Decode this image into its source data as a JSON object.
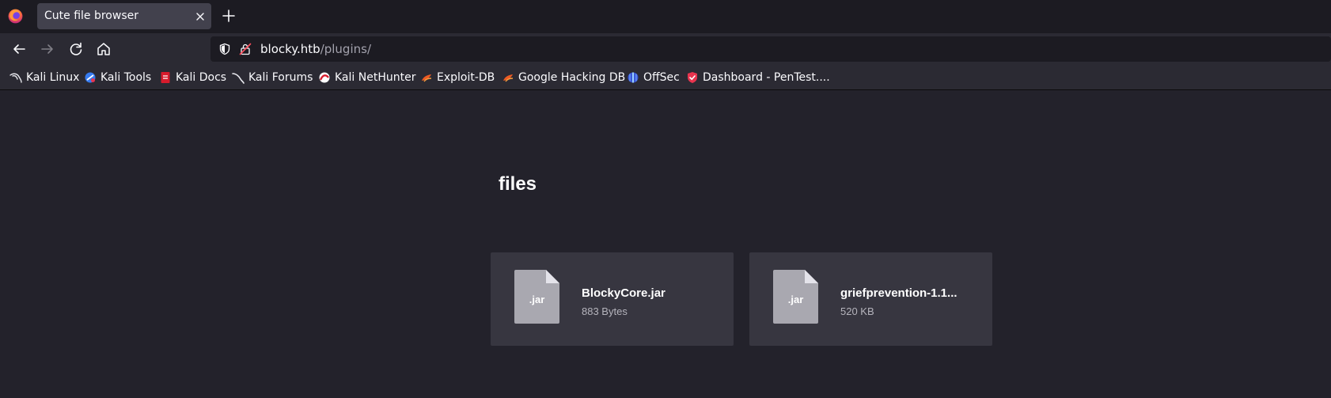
{
  "browser": {
    "tab": {
      "title": "Cute file browser"
    },
    "url": {
      "host": "blocky.htb",
      "path": "/plugins/"
    },
    "bookmarks": [
      {
        "label": "Kali Linux",
        "icon": "kali-dragon-icon"
      },
      {
        "label": "Kali Tools",
        "icon": "kali-tools-icon"
      },
      {
        "label": "Kali Docs",
        "icon": "kali-docs-icon"
      },
      {
        "label": "Kali Forums",
        "icon": "kali-forums-icon"
      },
      {
        "label": "Kali NetHunter",
        "icon": "nethunter-icon"
      },
      {
        "label": "Exploit-DB",
        "icon": "exploit-db-icon"
      },
      {
        "label": "Google Hacking DB",
        "icon": "ghdb-icon"
      },
      {
        "label": "OffSec",
        "icon": "offsec-icon"
      },
      {
        "label": "Dashboard - PenTest....",
        "icon": "pentest-shield-icon"
      }
    ]
  },
  "page": {
    "heading": "files",
    "files": [
      {
        "name": "BlockyCore.jar",
        "size": "883 Bytes",
        "ext": ".jar"
      },
      {
        "name": "griefprevention-1.1...",
        "size": "520 KB",
        "ext": ".jar"
      }
    ]
  },
  "colors": {
    "tabstrip": "#1c1b22",
    "toolbar": "#2b2a33",
    "page_background": "#23222b",
    "card": "#373640",
    "file_icon": "#a9a8b0"
  }
}
